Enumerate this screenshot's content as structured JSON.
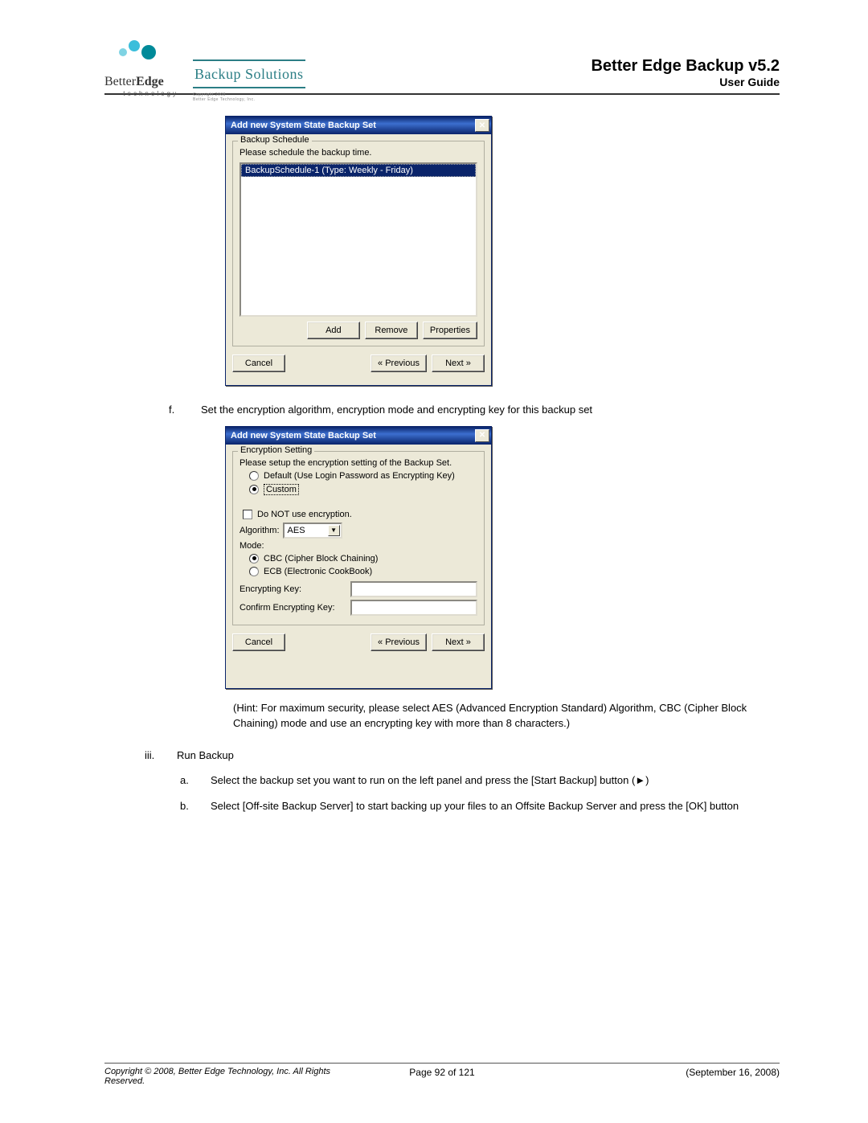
{
  "header": {
    "product_title": "Better Edge Backup v5.2",
    "subtitle": "User Guide",
    "backup_solutions_label": "Backup Solutions",
    "betteredge_brand_better": "Better",
    "betteredge_brand_edge": "Edge",
    "betteredge_tagline": "technology",
    "small_copyright_logo_line1": "Copyright 2008",
    "small_copyright_logo_line2": "Better Edge Technology, Inc."
  },
  "dialog1": {
    "title": "Add new  System State Backup Set",
    "group_title": "Backup Schedule",
    "group_subtitle": "Please schedule the backup time.",
    "list_items": [
      "BackupSchedule-1 (Type: Weekly - Friday)"
    ],
    "buttons": {
      "add": "Add",
      "remove": "Remove",
      "properties": "Properties",
      "cancel": "Cancel",
      "previous": "« Previous",
      "next": "Next »"
    }
  },
  "step_f": {
    "marker": "f.",
    "text": "Set the encryption algorithm, encryption mode and encrypting key for this backup set"
  },
  "dialog2": {
    "title": "Add new  System State Backup Set",
    "group_title": "Encryption Setting",
    "group_subtitle": "Please setup the encryption setting of the Backup Set.",
    "radio_default": "Default (Use Login Password as Encrypting Key)",
    "radio_custom": "Custom",
    "check_no_encryption": "Do NOT use encryption.",
    "algorithm_label": "Algorithm:",
    "algorithm_value": "AES",
    "mode_label": "Mode:",
    "mode_cbc": "CBC (Cipher Block Chaining)",
    "mode_ecb": "ECB (Electronic CookBook)",
    "enc_key_label": "Encrypting Key:",
    "enc_key_value": "",
    "confirm_label": "Confirm Encrypting Key:",
    "confirm_value": "",
    "buttons": {
      "cancel": "Cancel",
      "previous": "« Previous",
      "next": "Next »"
    }
  },
  "hint": "(Hint: For maximum security, please select AES (Advanced Encryption Standard) Algorithm, CBC (Cipher Block Chaining) mode and use an encrypting key with more than 8 characters.)",
  "step_iii": {
    "marker": "iii.",
    "label": "Run Backup",
    "a_marker": "a.",
    "a_text": "Select the backup set you want to run on the left panel and press the [Start Backup] button (►)",
    "b_marker": "b.",
    "b_text": "Select [Off-site Backup Server] to start backing up your files to an Offsite Backup Server and press the [OK] button"
  },
  "footer": {
    "copyright": "Copyright © 2008, Better Edge Technology, Inc.   All Rights Reserved.",
    "page": "Page 92 of 121",
    "date": "(September 16, 2008)"
  }
}
